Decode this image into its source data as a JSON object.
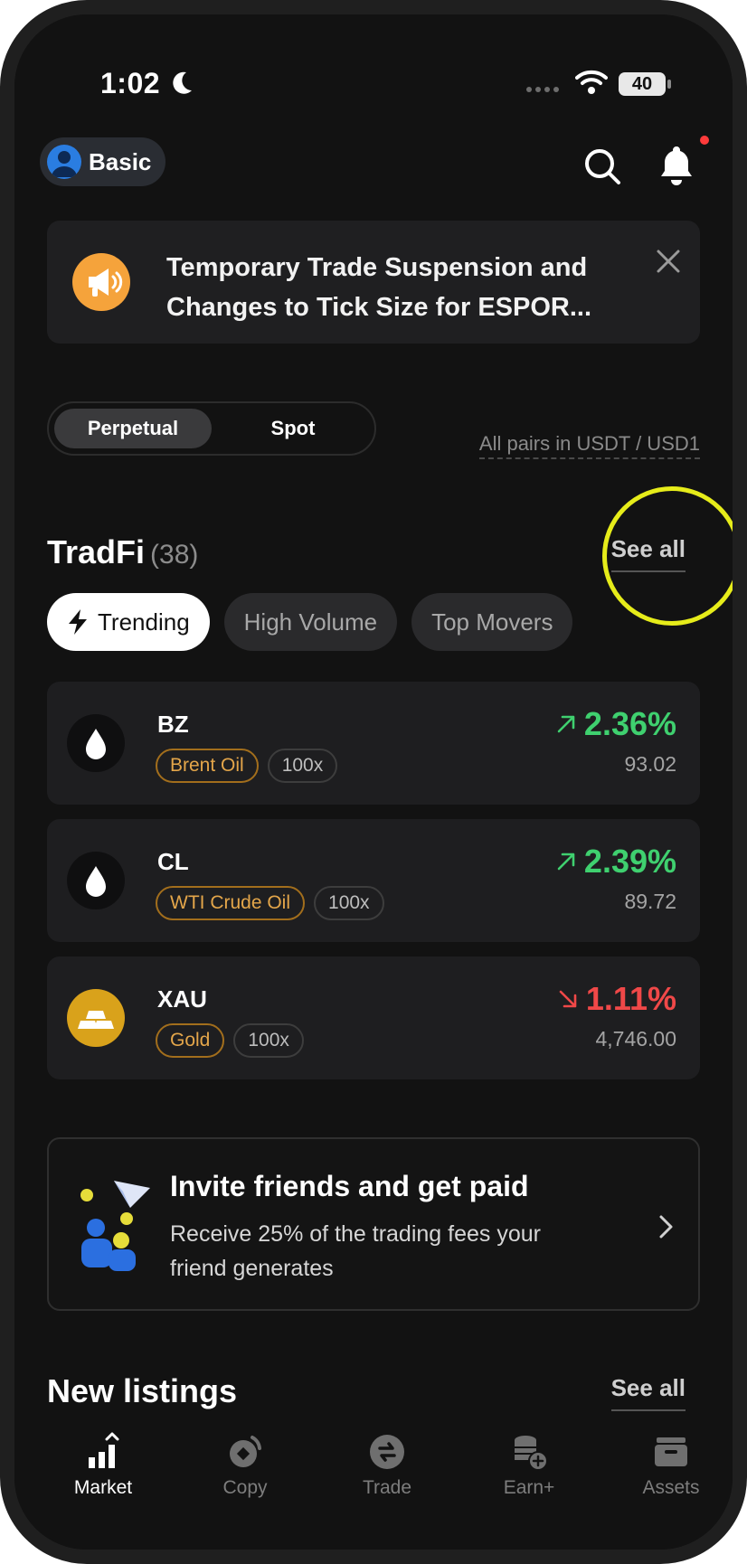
{
  "status_bar": {
    "time": "1:02",
    "battery": "40"
  },
  "header": {
    "account_label": "Basic"
  },
  "announcement": {
    "text_line1": "Temporary Trade Suspension and",
    "text_line2": "Changes to Tick Size for ESPOR..."
  },
  "market_toggle": {
    "options": [
      "Perpetual",
      "Spot"
    ],
    "selected": "Perpetual",
    "pairs_note": "All pairs in USDT / USD1"
  },
  "tradfi": {
    "title": "TradFi",
    "count": "(38)",
    "see_all": "See all",
    "chips": [
      "Trending",
      "High Volume",
      "Top Movers"
    ],
    "assets": [
      {
        "symbol": "BZ",
        "name": "Brent Oil",
        "leverage": "100x",
        "change": "2.36%",
        "direction": "up",
        "price": "93.02",
        "icon": "oil-drop-icon"
      },
      {
        "symbol": "CL",
        "name": "WTI Crude Oil",
        "leverage": "100x",
        "change": "2.39%",
        "direction": "up",
        "price": "89.72",
        "icon": "oil-drop-icon"
      },
      {
        "symbol": "XAU",
        "name": "Gold",
        "leverage": "100x",
        "change": "1.11%",
        "direction": "down",
        "price": "4,746.00",
        "icon": "gold-bars-icon"
      }
    ]
  },
  "invite": {
    "title": "Invite friends and get paid",
    "desc_line1": "Receive 25% of the trading fees your",
    "desc_line2": "friend generates"
  },
  "new_listings": {
    "title": "New listings",
    "see_all": "See all"
  },
  "nav": [
    {
      "label": "Market",
      "icon": "market-chart-icon",
      "active": true
    },
    {
      "label": "Copy",
      "icon": "copy-trade-icon",
      "active": false
    },
    {
      "label": "Trade",
      "icon": "trade-swap-icon",
      "active": false
    },
    {
      "label": "Earn+",
      "icon": "earn-coins-icon",
      "active": false
    },
    {
      "label": "Assets",
      "icon": "wallet-icon",
      "active": false
    }
  ],
  "colors": {
    "up": "#3fd06f",
    "down": "#f04848",
    "accent_orange": "#f5a33b",
    "highlight": "#e6ec1a"
  }
}
